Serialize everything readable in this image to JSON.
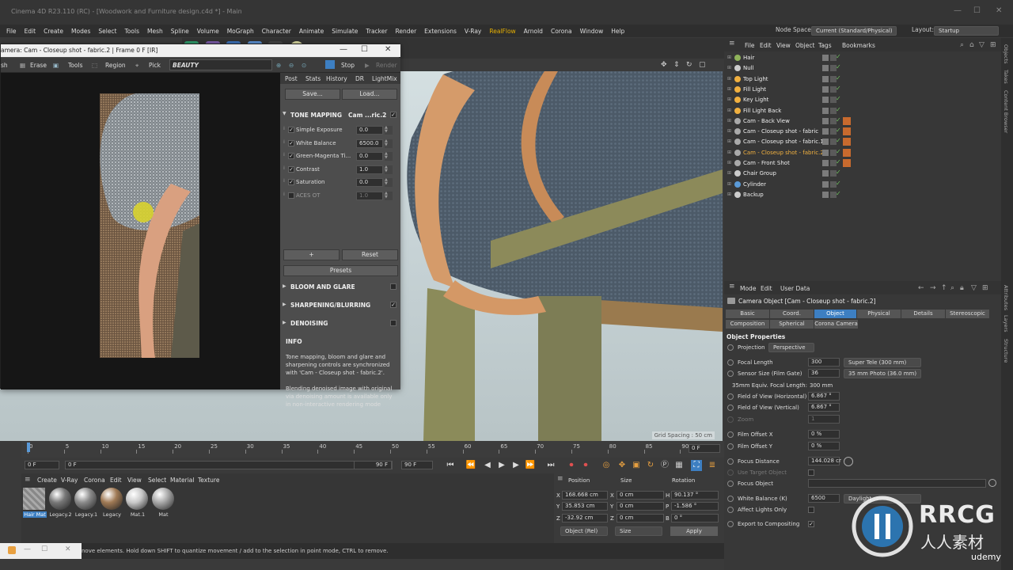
{
  "window": {
    "title": "Cinema 4D R23.110 (RC) - [Woodwork and Furniture design.c4d *] - Main"
  },
  "menubar": {
    "items": [
      "File",
      "Edit",
      "Create",
      "Modes",
      "Select",
      "Tools",
      "Mesh",
      "Spline",
      "Volume",
      "MoGraph",
      "Character",
      "Animate",
      "Simulate",
      "Tracker",
      "Render",
      "Extensions",
      "V-Ray",
      "RealFlow",
      "Arnold",
      "Corona",
      "Window",
      "Help"
    ],
    "highlight": "RealFlow",
    "node_space_label": "Node Space:",
    "node_space_value": "Current (Standard/Physical)",
    "layout_label": "Layout:",
    "layout_value": "Startup"
  },
  "ir_window": {
    "title": "amera: Cam - Closeup shot - fabric.2 | Frame 0 F [IR]",
    "toolbar": {
      "sh": "sh",
      "erase": "Erase",
      "tools": "Tools",
      "region": "Region",
      "pick": "Pick",
      "beauty": "BEAUTY",
      "stop": "Stop",
      "render": "Render"
    },
    "tabs": [
      "Post",
      "Stats",
      "History",
      "DR",
      "LightMix"
    ],
    "save": "Save...",
    "load": "Load...",
    "tone_mapping": {
      "title": "TONE MAPPING",
      "camera": "Cam ...ric.2",
      "params": [
        {
          "label": "Simple Exposure",
          "value": "0.0",
          "checked": true
        },
        {
          "label": "White Balance",
          "value": "6500.0",
          "checked": true
        },
        {
          "label": "Green-Magenta Ti...",
          "value": "0.0",
          "checked": true
        },
        {
          "label": "Contrast",
          "value": "1.0",
          "checked": true
        },
        {
          "label": "Saturation",
          "value": "0.0",
          "checked": true
        },
        {
          "label": "ACES OT",
          "value": "1.0",
          "checked": false
        }
      ],
      "plus": "+",
      "reset": "Reset",
      "presets": "Presets"
    },
    "sections": [
      {
        "title": "BLOOM AND GLARE",
        "checked": false
      },
      {
        "title": "SHARPENING/BLURRING",
        "checked": true
      },
      {
        "title": "DENOISING",
        "checked": false
      }
    ],
    "info": {
      "title": "INFO",
      "p1": "Tone mapping, bloom and glare and sharpening controls are synchronized with 'Cam - Closeup shot - fabric.2'.",
      "p2": "Blending denoised image with original via denoising amount is available only in non-interactive rendering mode"
    }
  },
  "viewport": {
    "grid_spacing": "Grid Spacing : 50 cm"
  },
  "objects_panel": {
    "menu": [
      "File",
      "Edit",
      "View",
      "Object",
      "Tags",
      "Bookmarks"
    ],
    "side_tabs": [
      "Objects",
      "Takes",
      "Content Browser"
    ],
    "rows": [
      {
        "name": "Hair",
        "color": "#8fb35a",
        "highlight": false
      },
      {
        "name": "Null",
        "color": "#cccccc",
        "highlight": false
      },
      {
        "name": "Top Light",
        "color": "#f0b040",
        "highlight": false
      },
      {
        "name": "Fill Light",
        "color": "#f0b040",
        "highlight": false
      },
      {
        "name": "Key Light",
        "color": "#f0b040",
        "highlight": false
      },
      {
        "name": "Fill Light Back",
        "color": "#f0b040",
        "highlight": false
      },
      {
        "name": "Cam - Back View",
        "color": "#aaaaaa",
        "highlight": false
      },
      {
        "name": "Cam - Closeup shot - fabric",
        "color": "#aaaaaa",
        "highlight": false
      },
      {
        "name": "Cam - Closeup shot - fabric.1",
        "color": "#aaaaaa",
        "highlight": false
      },
      {
        "name": "Cam - Closeup shot - fabric.2",
        "color": "#aaaaaa",
        "highlight": true
      },
      {
        "name": "Cam - Front Shot",
        "color": "#aaaaaa",
        "highlight": false
      },
      {
        "name": "Chair Group",
        "color": "#cccccc",
        "highlight": false
      },
      {
        "name": "Cylinder",
        "color": "#5a9ad8",
        "highlight": false
      },
      {
        "name": "Backup",
        "color": "#cccccc",
        "highlight": false
      }
    ]
  },
  "attributes": {
    "menu": [
      "Mode",
      "Edit",
      "User Data"
    ],
    "side_tabs": [
      "Attributes",
      "Layers",
      "Structure"
    ],
    "object_title": "Camera Object [Cam - Closeup shot - fabric.2]",
    "tabs_row1": [
      "Basic",
      "Coord.",
      "Object",
      "Physical",
      "Details",
      "Stereoscopic"
    ],
    "tabs_row2": [
      "Composition",
      "Spherical",
      "Corona Camera"
    ],
    "active_tab": "Object",
    "section": "Object Properties",
    "projection_label": "Projection",
    "projection_value": "Perspective",
    "focal_length_label": "Focal Length",
    "focal_length_value": "300",
    "focal_length_preset": "Super Tele (300 mm)",
    "sensor_label": "Sensor Size (Film Gate)",
    "sensor_value": "36",
    "sensor_preset": "35 mm Photo (36.0 mm)",
    "equiv_label": "35mm Equiv. Focal Length:",
    "equiv_value": "300 mm",
    "fov_h_label": "Field of View (Horizontal)",
    "fov_h_value": "6.867 °",
    "fov_v_label": "Field of View (Vertical)",
    "fov_v_value": "6.867 °",
    "zoom_label": "Zoom",
    "zoom_value": "1",
    "film_x_label": "Film Offset X",
    "film_x_value": "0 %",
    "film_y_label": "Film Offset Y",
    "film_y_value": "0 %",
    "focus_dist_label": "Focus Distance",
    "focus_dist_value": "144.028 cr",
    "use_target_label": "Use Target Object",
    "focus_obj_label": "Focus Object",
    "wb_label": "White Balance (K)",
    "wb_value": "6500",
    "wb_preset": "Daylight",
    "affect_label": "Affect Lights Only",
    "export_label": "Export to Compositing"
  },
  "timeline": {
    "ticks": [
      "0",
      "5",
      "10",
      "15",
      "20",
      "25",
      "30",
      "35",
      "40",
      "45",
      "50",
      "55",
      "60",
      "65",
      "70",
      "75",
      "80",
      "85",
      "90"
    ],
    "start": "0 F",
    "start2": "0 F",
    "end": "90 F",
    "end2": "90 F",
    "current": "0 F"
  },
  "materials": {
    "menu": [
      "Create",
      "V-Ray",
      "Corona",
      "Edit",
      "View",
      "Select",
      "Material",
      "Texture"
    ],
    "items": [
      {
        "name": "Hair Mat",
        "color": "#9a9a9a"
      },
      {
        "name": "Legacy.2",
        "color": "#777777"
      },
      {
        "name": "Legacy.1",
        "color": "#8a8a8a"
      },
      {
        "name": "Legacy",
        "color": "#a07a55"
      },
      {
        "name": "Mat.1",
        "color": "#c8c8c8"
      },
      {
        "name": "Mat",
        "color": "#a8a8a8"
      }
    ]
  },
  "coordinates": {
    "header": [
      "Position",
      "Size",
      "Rotation"
    ],
    "x_pos": "168.668 cm",
    "x_size": "0 cm",
    "h_rot": "90.137 °",
    "y_pos": "35.853 cm",
    "y_size": "0 cm",
    "p_rot": "-1.586 °",
    "z_pos": "-32.92 cm",
    "z_size": "0 cm",
    "b_rot": "0 °",
    "mode": "Object (Rel)",
    "size_mode": "Size",
    "apply": "Apply"
  },
  "status": {
    "text": "nove elements. Hold down SHIFT to quantize movement / add to the selection in point mode, CTRL to remove."
  },
  "watermark": {
    "brand": "RRCG",
    "sub": "人人素材",
    "udemy": "udemy"
  }
}
